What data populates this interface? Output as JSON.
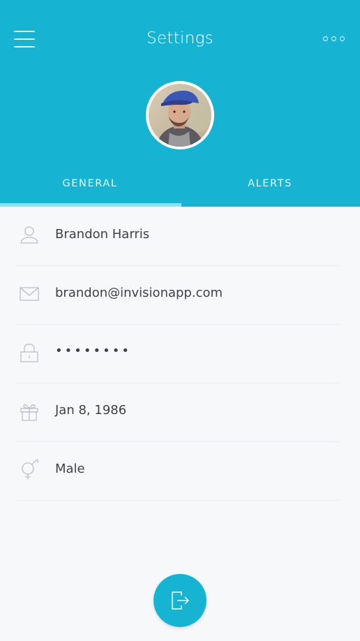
{
  "header": {
    "title": "Settings",
    "menu_icon": "hamburger-menu-icon",
    "more_icon": "more-dots-icon"
  },
  "profile": {
    "avatar": "profile-photo"
  },
  "tabs": [
    {
      "label": "GENERAL",
      "active": true
    },
    {
      "label": "ALERTS",
      "active": false
    }
  ],
  "fields": [
    {
      "icon": "user-icon",
      "value": "Brandon Harris"
    },
    {
      "icon": "mail-icon",
      "value": "brandon@invisionapp.com"
    },
    {
      "icon": "lock-icon",
      "value": "••••••••"
    },
    {
      "icon": "gift-icon",
      "value": "Jan 8, 1986"
    },
    {
      "icon": "gender-icon",
      "value": "Male"
    }
  ],
  "logout": {
    "icon": "logout-icon"
  },
  "colors": {
    "accent": "#16b3d3",
    "tab_indicator": "#8ee0ee",
    "text": "#3c4247",
    "background": "#f7f8f9"
  }
}
